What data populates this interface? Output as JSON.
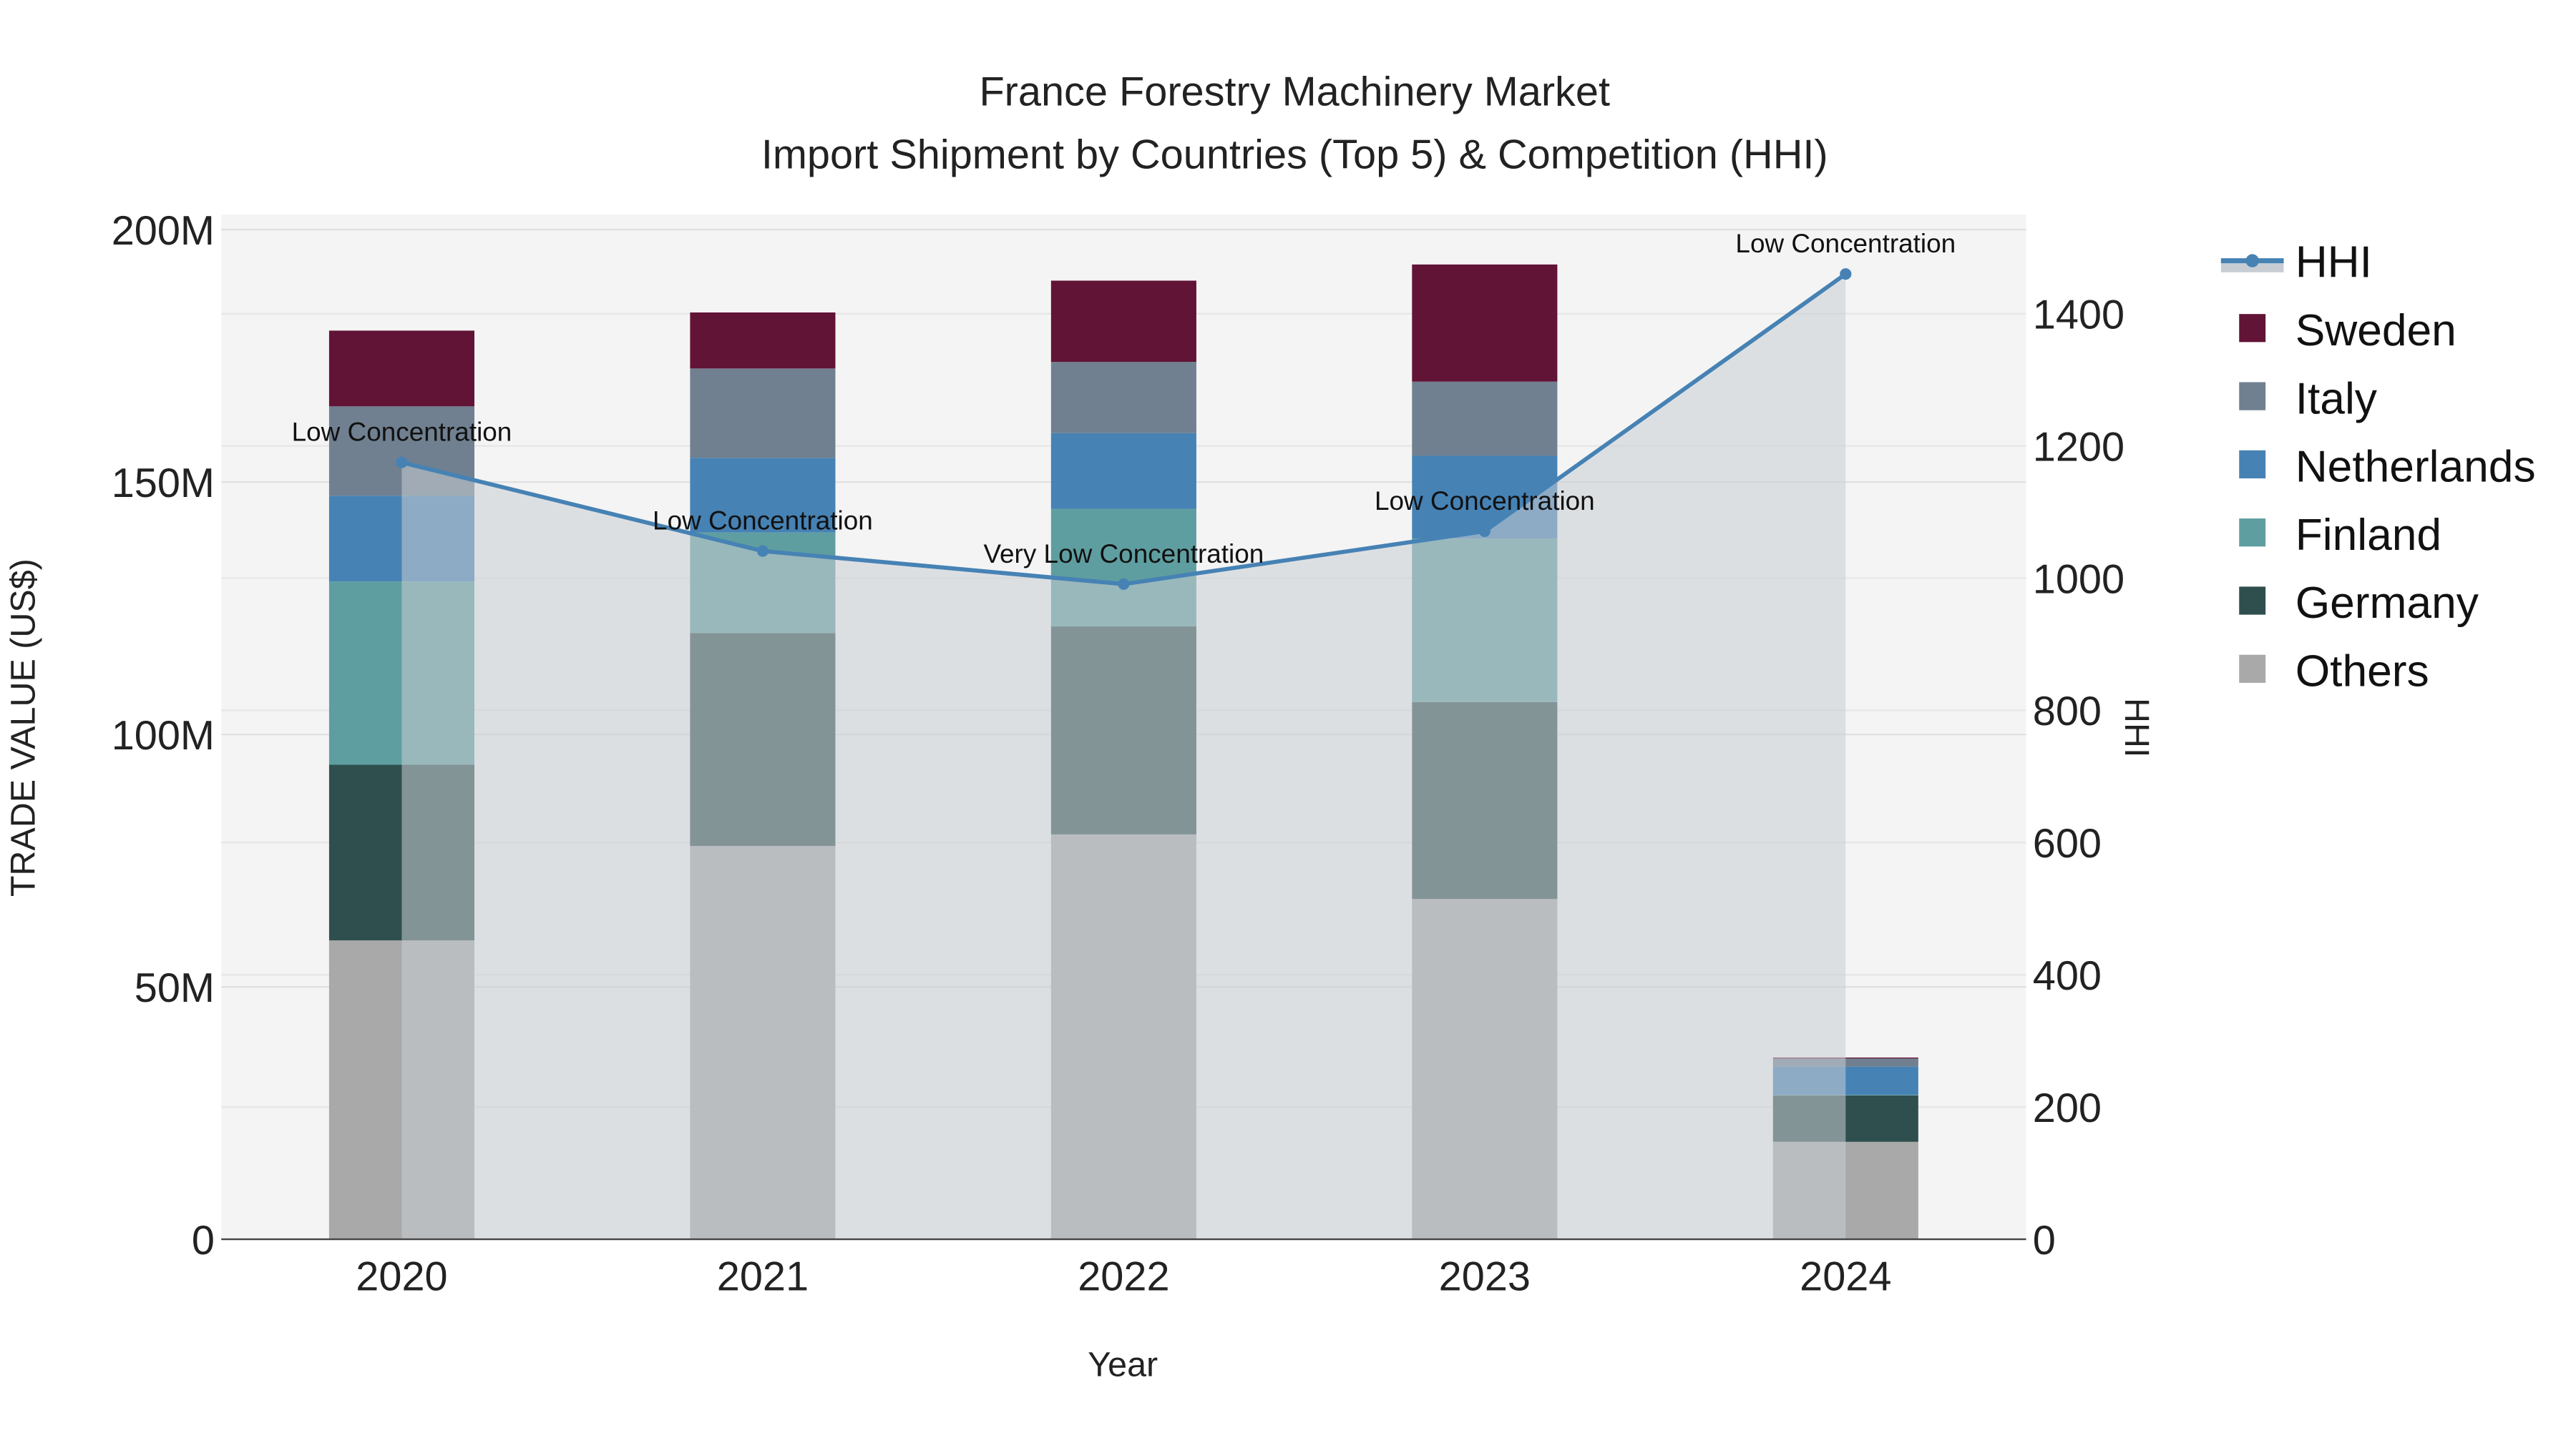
{
  "chart_data": {
    "type": "bar",
    "title": "France Forestry Machinery Market",
    "subtitle": "Import Shipment by Countries (Top 5) & Competition (HHI)",
    "xlabel": "Year",
    "ylabel": "TRADE VALUE (US$)",
    "y2label": "HHI",
    "categories": [
      "2020",
      "2021",
      "2022",
      "2023",
      "2024"
    ],
    "ylim": [
      0,
      203
    ],
    "y_ticks": [
      0,
      50,
      100,
      150,
      200
    ],
    "y_tick_labels": [
      "0",
      "50M",
      "100M",
      "150M",
      "200M"
    ],
    "y2lim": [
      0,
      1550
    ],
    "y2_ticks": [
      0,
      200,
      400,
      600,
      800,
      1000,
      1200,
      1400
    ],
    "y2_tick_labels": [
      "0",
      "200",
      "400",
      "600",
      "800",
      "1000",
      "1200",
      "1400"
    ],
    "units": "million US$",
    "barmode": "stack",
    "series": [
      {
        "name": "Others",
        "color": "#A9A9A9",
        "values": [
          59.2,
          77.9,
          80.2,
          67.4,
          19.3
        ]
      },
      {
        "name": "Germany",
        "color": "#2F4F4F",
        "values": [
          34.8,
          42.2,
          41.2,
          39.0,
          9.2
        ]
      },
      {
        "name": "Finland",
        "color": "#5F9EA0",
        "values": [
          36.3,
          19.9,
          23.3,
          32.4,
          0.1
        ]
      },
      {
        "name": "Netherlands",
        "color": "#4682B4",
        "values": [
          17.0,
          14.8,
          15.0,
          16.4,
          5.6
        ]
      },
      {
        "name": "Italy",
        "color": "#708090",
        "values": [
          17.7,
          17.7,
          14.1,
          14.7,
          1.6
        ]
      },
      {
        "name": "Sweden",
        "color": "#621436",
        "values": [
          15.0,
          11.1,
          16.1,
          23.2,
          0.2
        ]
      }
    ],
    "line_series": {
      "name": "HHI",
      "color": "#4682B4",
      "fill": "#C8CDD4",
      "values": [
        1175,
        1041,
        991,
        1071,
        1460
      ],
      "annotations": [
        "Low Concentration",
        "Low Concentration",
        "Very Low Concentration",
        "Low Concentration",
        "Low Concentration"
      ]
    },
    "legend": {
      "placement": "right",
      "order": [
        "HHI",
        "Sweden",
        "Italy",
        "Netherlands",
        "Finland",
        "Germany",
        "Others"
      ]
    },
    "grid": true
  }
}
